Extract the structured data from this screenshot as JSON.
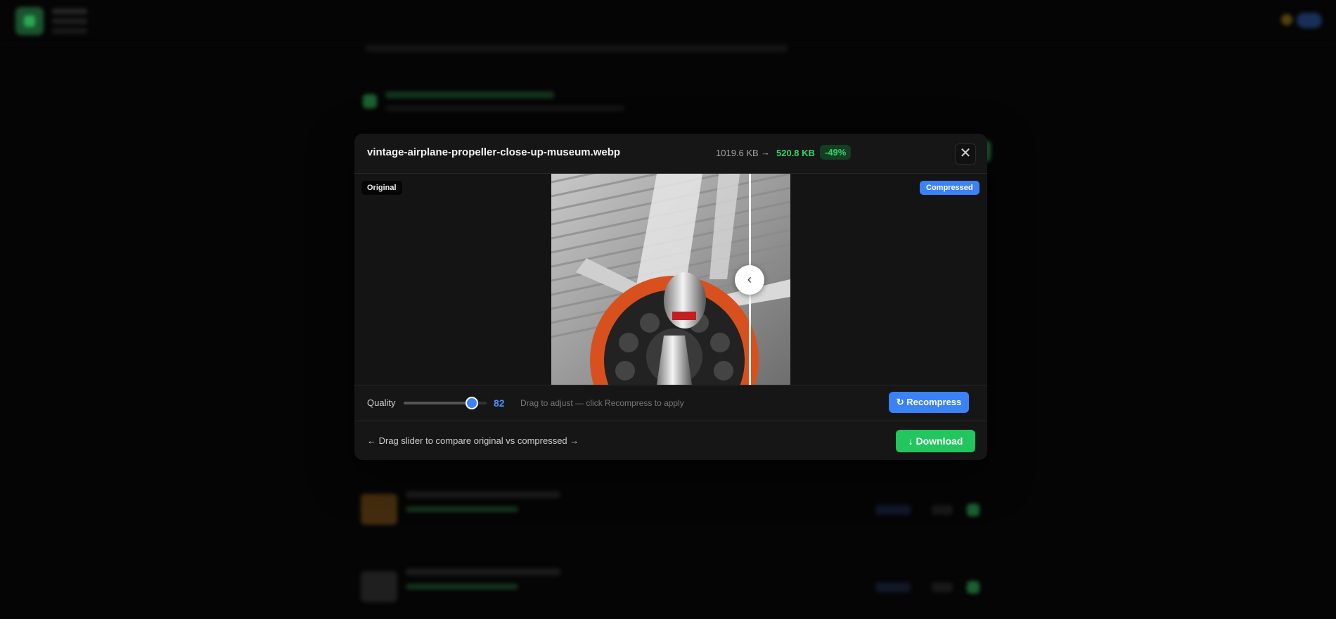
{
  "modal": {
    "filename": "vintage-airplane-propeller-close-up-museum.webp",
    "original_size": "1019.6 KB",
    "arrow": "→",
    "compressed_size": "520.8 KB",
    "reduction": "-49%",
    "close_glyph": "✕"
  },
  "compare": {
    "label_original": "Original",
    "label_compressed": "Compressed",
    "handle_glyph": "‹"
  },
  "quality": {
    "label": "Quality",
    "value": "82",
    "slider_fraction": 0.82,
    "hint": "Drag to adjust — click Recompress to apply",
    "recompress_label": "↻ Recompress"
  },
  "footer": {
    "hint": "← Drag slider to compare original vs compressed →",
    "download_label": "↓ Download"
  },
  "colors": {
    "accent_blue": "#3b82f6",
    "accent_green": "#22c55e",
    "badge_green": "#34d46a"
  },
  "icons": [
    "close-icon",
    "chevron-left-icon",
    "refresh-icon",
    "arrow-down-icon"
  ]
}
